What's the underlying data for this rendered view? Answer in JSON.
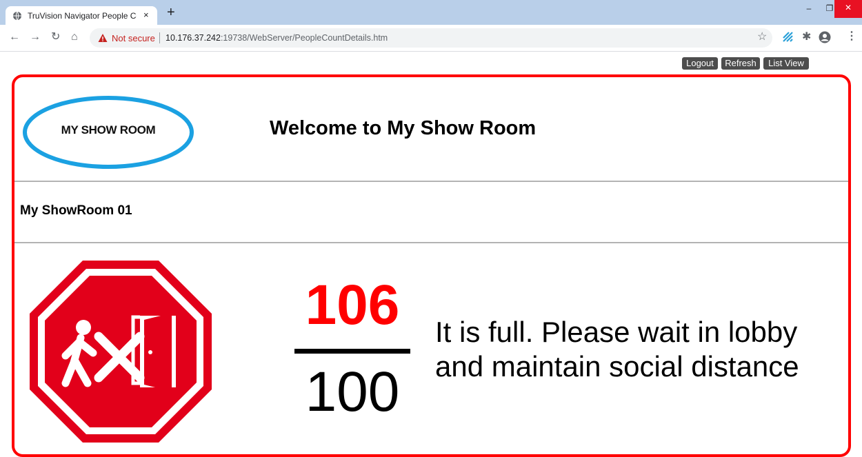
{
  "browser": {
    "tab_title": "TruVision Navigator People Coun",
    "tab_close": "×",
    "new_tab": "+",
    "window_min": "–",
    "window_max": "❐",
    "window_close": "✕",
    "nav_back": "←",
    "nav_forward": "→",
    "nav_reload": "↻",
    "nav_home": "⌂",
    "security_label": "Not secure",
    "url_host": "10.176.37.242",
    "url_path": ":19738/WebServer/PeopleCountDetails.htm",
    "bookmark_star": "☆",
    "extensions_icon": "✱",
    "menu_icon": "⋮",
    "accent_colors": {
      "tabstrip": "#b9cfe9",
      "warning": "#c5221f",
      "close": "#e81123"
    }
  },
  "header_links": {
    "logout": "Logout",
    "refresh": "Refresh",
    "list_view": "List View"
  },
  "page": {
    "logo_text": "MY SHOW ROOM",
    "welcome_title": "Welcome to My Show Room",
    "room_name": "My ShowRoom 01",
    "current_count": "106",
    "max_capacity": "100",
    "status_message_line1": "It is full. Please wait in lobby",
    "status_message_line2": "and maintain social distance",
    "status_icon": "no-entry-stop-icon",
    "colors": {
      "frame": "#ff0000",
      "count": "#ff0000",
      "logo_ellipse": "#1ba1e2",
      "stop_sign": "#e2001a"
    }
  }
}
